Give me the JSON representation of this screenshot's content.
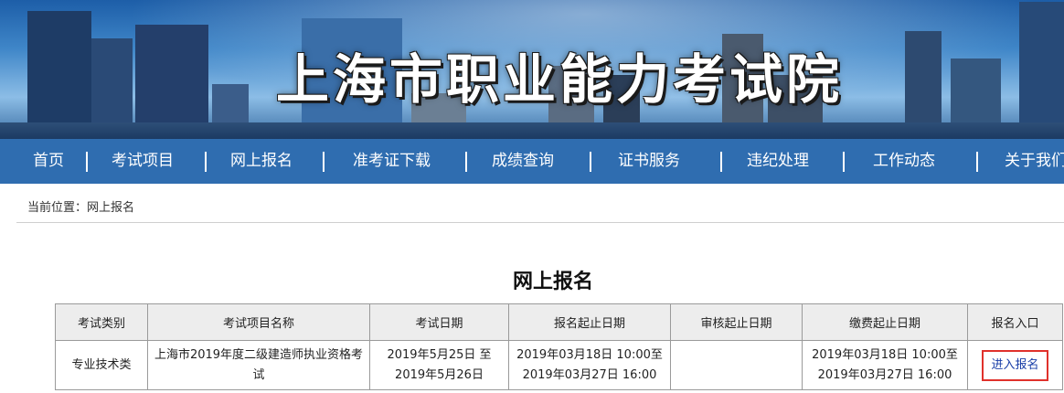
{
  "header": {
    "site_title": "上海市职业能力考试院"
  },
  "nav": {
    "items": [
      {
        "label": "首页"
      },
      {
        "label": "考试项目"
      },
      {
        "label": "网上报名"
      },
      {
        "label": "准考证下载"
      },
      {
        "label": "成绩查询"
      },
      {
        "label": "证书服务"
      },
      {
        "label": "违纪处理"
      },
      {
        "label": "工作动态"
      },
      {
        "label": "关于我们"
      }
    ]
  },
  "breadcrumb": {
    "text": "当前位置：网上报名"
  },
  "main": {
    "title": "网上报名",
    "table": {
      "headers": [
        "考试类别",
        "考试项目名称",
        "考试日期",
        "报名起止日期",
        "审核起止日期",
        "缴费起止日期",
        "报名入口"
      ],
      "rows": [
        {
          "category": "专业技术类",
          "name": "上海市2019年度二级建造师执业资格考试",
          "exam_date": "2019年5月25日 至 2019年5月26日",
          "register_period": "2019年03月18日 10:00至2019年03月27日 16:00",
          "review_period": "",
          "payment_period": "2019年03月18日 10:00至2019年03月27日 16:00",
          "entry_label": "进入报名"
        }
      ]
    }
  },
  "colors": {
    "nav_bg": "#2f6db0",
    "link": "#1a3fa8",
    "highlight_border": "#e0312b"
  }
}
